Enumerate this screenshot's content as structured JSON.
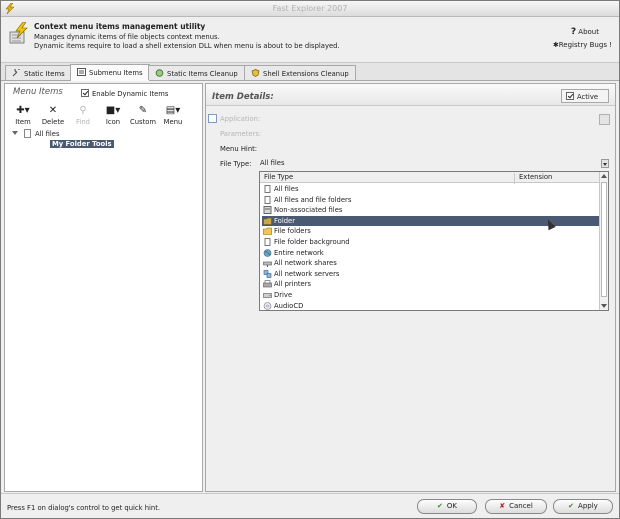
{
  "window": {
    "title": "Fast Explorer 2007"
  },
  "header": {
    "title": "Context menu items management utility",
    "desc_line1": "Manages dynamic items of file objects context menus.",
    "desc_line2": "Dynamic items require to load a shell extension DLL when menu is about to be displayed.",
    "about_label": "About",
    "bugs_label": "Registry Bugs !"
  },
  "tabs": [
    {
      "label": "Static Items",
      "icon": "wrench-icon"
    },
    {
      "label": "Submenu Items",
      "icon": "submenu-icon",
      "active": true
    },
    {
      "label": "Static Items Cleanup",
      "icon": "cleanup-icon"
    },
    {
      "label": "Shell Extensions Cleanup",
      "icon": "shield-icon"
    }
  ],
  "left_pane": {
    "title": "Menu Items",
    "enable_dynamic_label": "Enable Dynamic Items",
    "enable_dynamic_checked": true,
    "toolbar": [
      {
        "label": "Item",
        "icon": "add-item-icon",
        "enabled": true
      },
      {
        "label": "Delete",
        "icon": "delete-icon",
        "enabled": true
      },
      {
        "label": "Find",
        "icon": "find-icon",
        "enabled": false
      },
      {
        "label": "Icon",
        "icon": "icon-picker-icon",
        "enabled": true
      },
      {
        "label": "Custom",
        "icon": "custom-icon",
        "enabled": true
      },
      {
        "label": "Menu",
        "icon": "menu-icon",
        "enabled": true
      }
    ],
    "tree": [
      {
        "label": "All files",
        "level": 0,
        "expanded": true
      },
      {
        "label": "My Folder Tools",
        "level": 1,
        "selected": true
      }
    ]
  },
  "right_pane": {
    "title": "Item Details:",
    "active_label": "Active",
    "active_checked": true,
    "application_label": "Application:",
    "parameters_label": "Parameters:",
    "menu_hint_label": "Menu Hint:",
    "file_type_label": "File Type:",
    "file_type_value": "All files",
    "dropdown": {
      "col_file_type": "File Type",
      "col_extension": "Extension",
      "items": [
        {
          "label": "All files",
          "icon": "file-icon"
        },
        {
          "label": "All files and file folders",
          "icon": "file-icon"
        },
        {
          "label": "Non-associated files",
          "icon": "unknown-file-icon"
        },
        {
          "label": "Folder",
          "icon": "folder-icon",
          "highlighted": true
        },
        {
          "label": "File folders",
          "icon": "folder-icon"
        },
        {
          "label": "File folder background",
          "icon": "file-icon"
        },
        {
          "label": "Entire network",
          "icon": "globe-icon"
        },
        {
          "label": "All network shares",
          "icon": "network-share-icon"
        },
        {
          "label": "All network servers",
          "icon": "network-server-icon"
        },
        {
          "label": "All printers",
          "icon": "printer-icon"
        },
        {
          "label": "Drive",
          "icon": "drive-icon"
        },
        {
          "label": "AudioCD",
          "icon": "cd-icon"
        }
      ]
    }
  },
  "footer": {
    "hint": "Press F1 on dialog's control to get quick hint.",
    "ok_label": "OK",
    "cancel_label": "Cancel",
    "apply_label": "Apply"
  },
  "colors": {
    "selection": "#4a5a72",
    "ok_check": "#3a8a2a",
    "cancel_x": "#b32525"
  }
}
